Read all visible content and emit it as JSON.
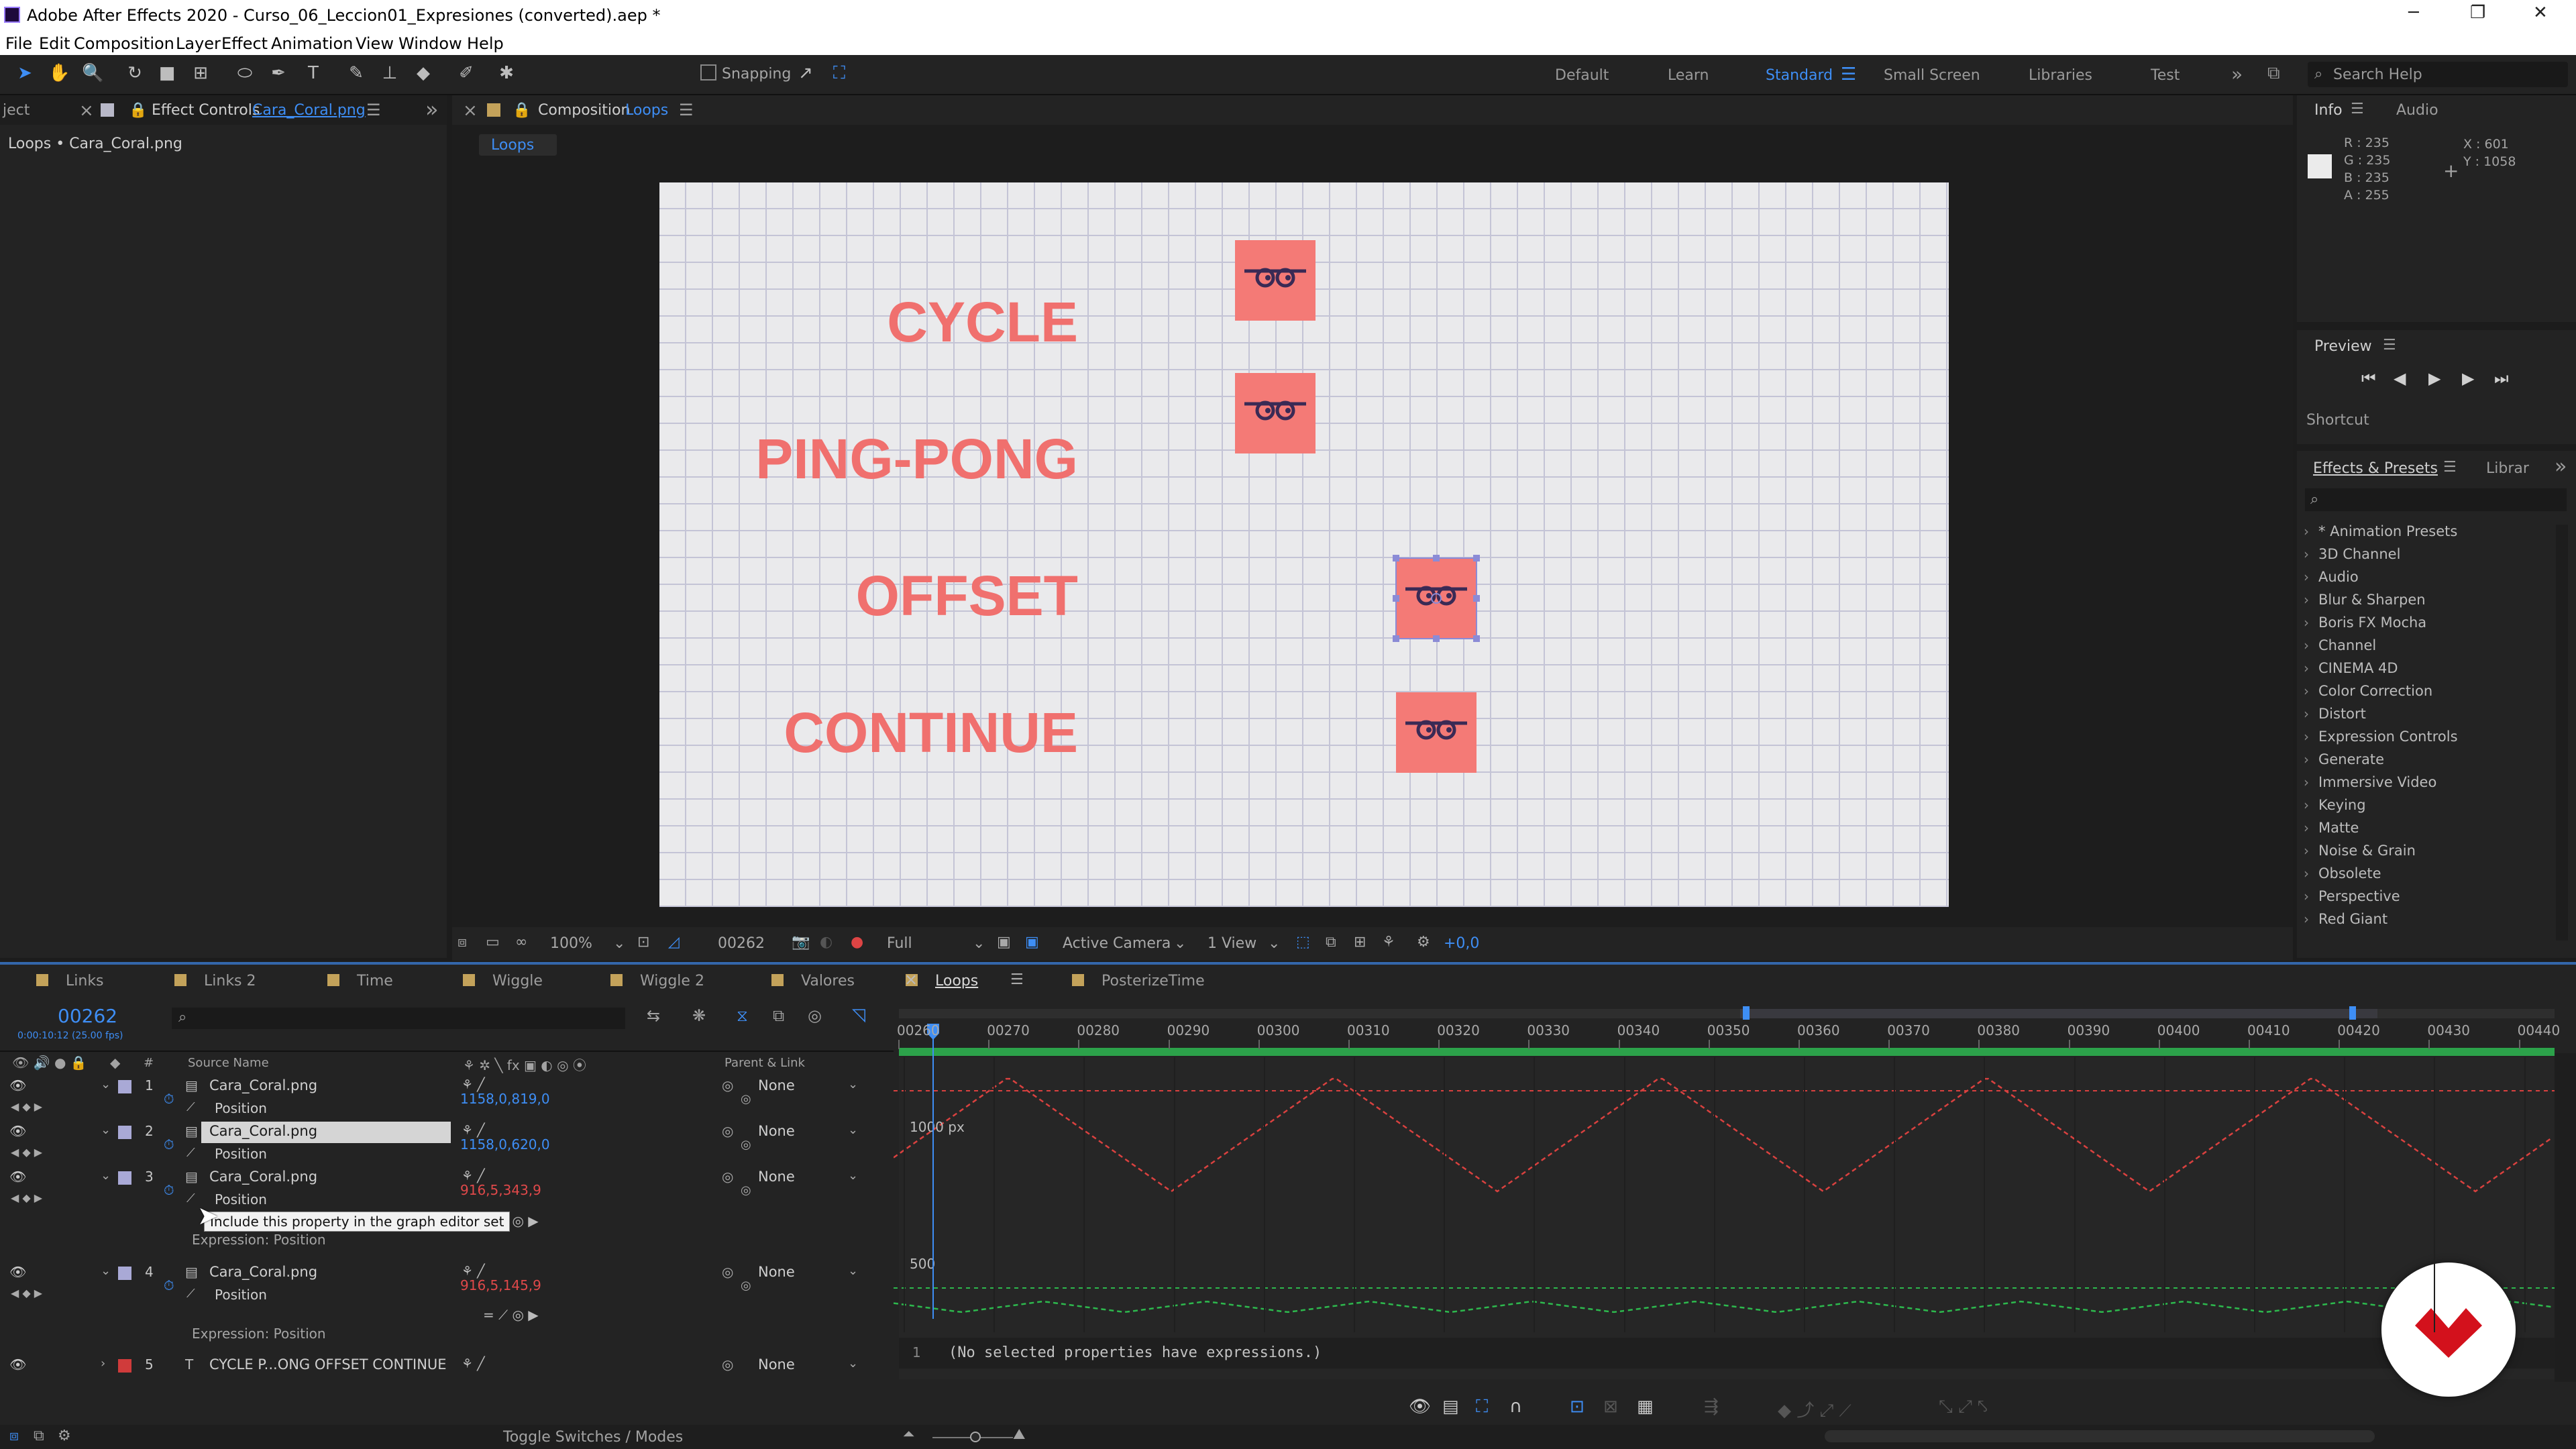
{
  "window": {
    "title": "Adobe After Effects 2020 - Curso_06_Leccion01_Expresiones (converted).aep *",
    "minimize": "─",
    "restore": "❐",
    "close": "✕"
  },
  "menu": [
    "File",
    "Edit",
    "Composition",
    "Layer",
    "Effect",
    "Animation",
    "View",
    "Window",
    "Help"
  ],
  "toolbar": {
    "snapping_label": "Snapping"
  },
  "workspaces": [
    "Default",
    "Learn",
    "Standard",
    "Small Screen",
    "Libraries",
    "Test"
  ],
  "active_workspace": "Standard",
  "search_help": {
    "placeholder": "Search Help"
  },
  "project_panel": {
    "tab_partial": "ject",
    "close": "×",
    "effect_controls_tab": "Effect Controls",
    "effect_controls_target": "Cara_Coral.png",
    "breadcrumb": "Loops • Cara_Coral.png"
  },
  "comp_panel": {
    "close": "×",
    "tab": "Composition",
    "comp_name": "Loops",
    "subtab": "Loops"
  },
  "canvas_words": [
    "CYCLE",
    "PING-PONG",
    "OFFSET",
    "CONTINUE"
  ],
  "viewer_bar": {
    "zoom": "100%",
    "timecode": "00262",
    "resolution": "Full",
    "camera": "Active Camera",
    "views": "1 View",
    "exposure": "+0,0"
  },
  "info_panel": {
    "tab": "Info",
    "tab2": "Audio",
    "r": "R : 235",
    "g": "G : 235",
    "b": "B : 235",
    "a": "A : 255",
    "x": "X : 601",
    "y": "Y : 1058"
  },
  "preview_panel": {
    "title": "Preview",
    "shortcut": "Shortcut"
  },
  "effects_panel": {
    "title": "Effects & Presets",
    "tab2": "Librar",
    "items": [
      "* Animation Presets",
      "3D Channel",
      "Audio",
      "Blur & Sharpen",
      "Boris FX Mocha",
      "Channel",
      "CINEMA 4D",
      "Color Correction",
      "Distort",
      "Expression Controls",
      "Generate",
      "Immersive Video",
      "Keying",
      "Matte",
      "Noise & Grain",
      "Obsolete",
      "Perspective",
      "Red Giant"
    ]
  },
  "timeline_tabs": [
    {
      "label": "Links",
      "color": "#c3a25a"
    },
    {
      "label": "Links 2",
      "color": "#c3a25a"
    },
    {
      "label": "Time",
      "color": "#c3a25a"
    },
    {
      "label": "Wiggle",
      "color": "#c3a25a"
    },
    {
      "label": "Wiggle 2",
      "color": "#c3a25a"
    },
    {
      "label": "Valores",
      "color": "#c3a25a"
    },
    {
      "label": "Loops",
      "color": "#c3a25a"
    },
    {
      "label": "PosterizeTime",
      "color": "#c3a25a"
    }
  ],
  "timeline": {
    "timecode": "00262",
    "fps": "0:00:10:12 (25.00 fps)",
    "col_source": "Source Name",
    "col_parent": "Parent & Link",
    "col_num": "#",
    "layers": [
      {
        "num": "1",
        "name": "Cara_Coral.png",
        "parent": "None",
        "prop": "Position",
        "value": "1158,0,819,0"
      },
      {
        "num": "2",
        "name": "Cara_Coral.png",
        "parent": "None",
        "prop": "Position",
        "value": "1158,0,620,0"
      },
      {
        "num": "3",
        "name": "Cara_Coral.png",
        "parent": "None",
        "prop": "Position",
        "value": "916,5,343,9",
        "expr": "Expression: Position"
      },
      {
        "num": "4",
        "name": "Cara_Coral.png",
        "parent": "None",
        "prop": "Position",
        "value": "916,5,145,9",
        "expr": "Expression: Position"
      },
      {
        "num": "5",
        "name": "CYCLE P...ONG OFFSET CONTINUE",
        "parent": "None"
      }
    ],
    "tooltip": "Include this property in the graph editor set",
    "toggle": "Toggle Switches / Modes"
  },
  "ruler": [
    "00260",
    "00270",
    "00280",
    "00290",
    "00300",
    "00310",
    "00320",
    "00330",
    "00340",
    "00350",
    "00360",
    "00370",
    "00380",
    "00390",
    "00400",
    "00410",
    "00420",
    "00430",
    "00440"
  ],
  "graph": {
    "label_1000": "1000 px",
    "label_500": "500",
    "expr_line_num": "1",
    "expr_text": "(No selected properties have expressions.)"
  },
  "colors": {
    "accent": "#3e8ef5",
    "coral": "#f0706e",
    "red_curve": "#d9413f",
    "green_curve": "#2db84d"
  }
}
